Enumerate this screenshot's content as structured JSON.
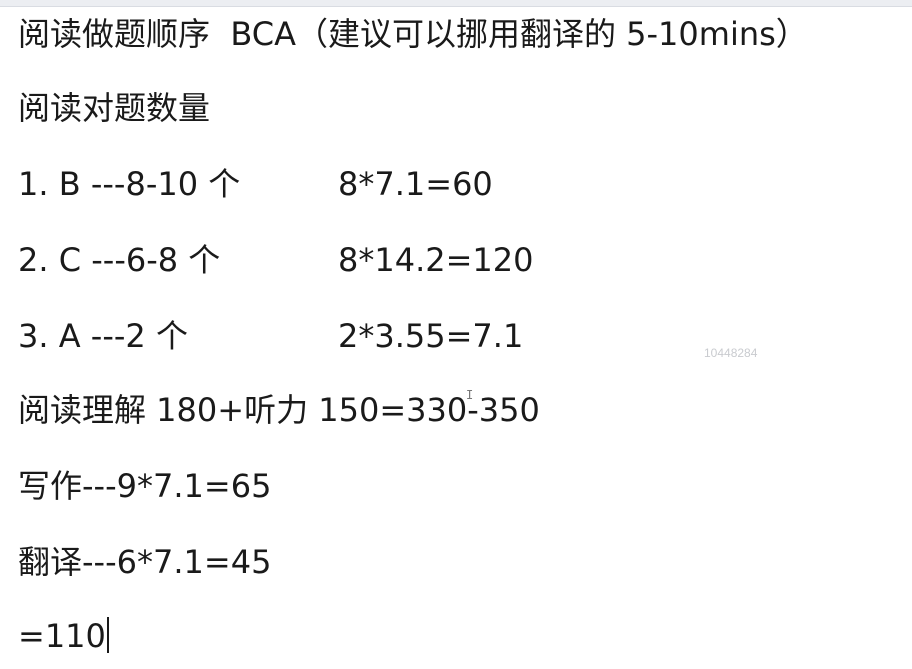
{
  "document": {
    "line1": "阅读做题顺序  BCA（建议可以挪用翻译的 5-10mins）",
    "line2": "阅读对题数量",
    "items": [
      {
        "label": "1. B ---8-10 个",
        "calc": "8*7.1=60"
      },
      {
        "label": "2. C ---6-8 个",
        "calc": "8*14.2=120"
      },
      {
        "label": "3. A ---2 个",
        "calc": "2*3.55=7.1"
      }
    ],
    "line6": "阅读理解 180+听力 150=330-350",
    "line7": "写作---9*7.1=65",
    "line8": "翻译---6*7.1=45",
    "line9": "=110"
  },
  "watermark": "10448284"
}
